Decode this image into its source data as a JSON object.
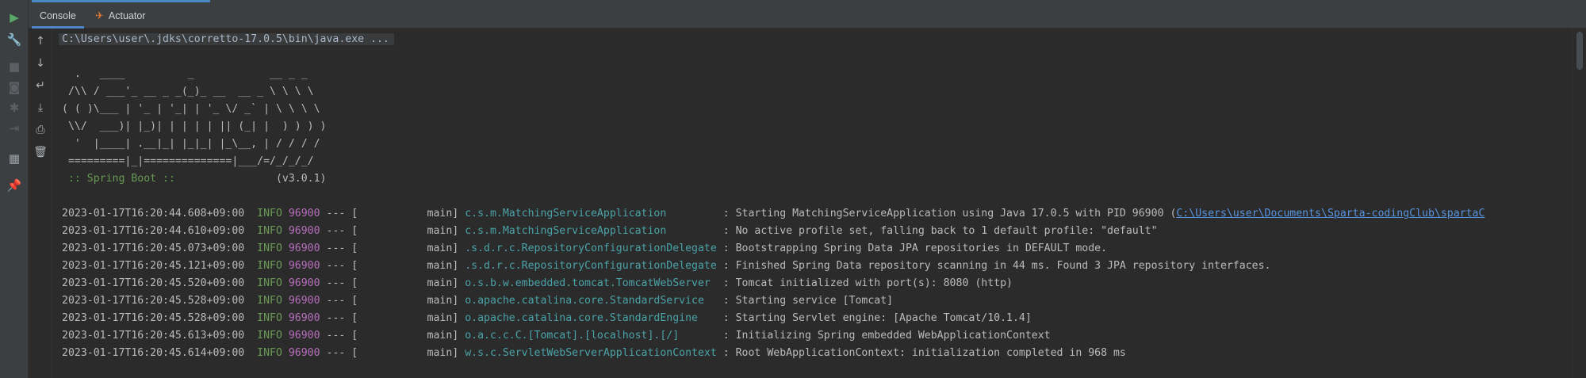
{
  "tabs": [
    {
      "label": "Console",
      "icon": "",
      "active": true
    },
    {
      "label": "Actuator",
      "icon": "actuator-icon",
      "active": false
    }
  ],
  "left_toolbar": [
    "run-icon",
    "wrench-icon",
    "stop-icon",
    "camera-icon",
    "debug-icon",
    "exit-icon",
    "layout-icon",
    "pin-icon"
  ],
  "console_toolbar": [
    "up-arrow-icon",
    "down-arrow-icon",
    "soft-wrap-icon",
    "scroll-to-end-icon",
    "print-icon",
    "trash-icon"
  ],
  "command": "C:\\Users\\user\\.jdks\\corretto-17.0.5\\bin\\java.exe ...",
  "banner": [
    "  .   ____          _            __ _ _",
    " /\\\\ / ___'_ __ _ _(_)_ __  __ _ \\ \\ \\ \\",
    "( ( )\\___ | '_ | '_| | '_ \\/ _` | \\ \\ \\ \\",
    " \\\\/  ___)| |_)| | | | | || (_| |  ) ) ) )",
    "  '  |____| .__|_| |_|_| |_\\__, | / / / /",
    " =========|_|==============|___/=/_/_/_/"
  ],
  "spring_label": " :: Spring Boot :: ",
  "spring_version": "               (v3.0.1)",
  "logs": [
    {
      "ts": "2023-01-17T16:20:44.608+09:00",
      "level": "INFO",
      "pid": "96900",
      "thread": "           main]",
      "logger": "c.s.m.MatchingServiceApplication        ",
      "msg": " : Starting MatchingServiceApplication using Java 17.0.5 with PID 96900 (",
      "link": "C:\\Users\\user\\Documents\\Sparta-codingClub\\spartaC"
    },
    {
      "ts": "2023-01-17T16:20:44.610+09:00",
      "level": "INFO",
      "pid": "96900",
      "thread": "           main]",
      "logger": "c.s.m.MatchingServiceApplication        ",
      "msg": " : No active profile set, falling back to 1 default profile: \"default\"",
      "link": ""
    },
    {
      "ts": "2023-01-17T16:20:45.073+09:00",
      "level": "INFO",
      "pid": "96900",
      "thread": "           main]",
      "logger": ".s.d.r.c.RepositoryConfigurationDelegate",
      "msg": " : Bootstrapping Spring Data JPA repositories in DEFAULT mode.",
      "link": ""
    },
    {
      "ts": "2023-01-17T16:20:45.121+09:00",
      "level": "INFO",
      "pid": "96900",
      "thread": "           main]",
      "logger": ".s.d.r.c.RepositoryConfigurationDelegate",
      "msg": " : Finished Spring Data repository scanning in 44 ms. Found 3 JPA repository interfaces.",
      "link": ""
    },
    {
      "ts": "2023-01-17T16:20:45.520+09:00",
      "level": "INFO",
      "pid": "96900",
      "thread": "           main]",
      "logger": "o.s.b.w.embedded.tomcat.TomcatWebServer ",
      "msg": " : Tomcat initialized with port(s): 8080 (http)",
      "link": ""
    },
    {
      "ts": "2023-01-17T16:20:45.528+09:00",
      "level": "INFO",
      "pid": "96900",
      "thread": "           main]",
      "logger": "o.apache.catalina.core.StandardService  ",
      "msg": " : Starting service [Tomcat]",
      "link": ""
    },
    {
      "ts": "2023-01-17T16:20:45.528+09:00",
      "level": "INFO",
      "pid": "96900",
      "thread": "           main]",
      "logger": "o.apache.catalina.core.StandardEngine   ",
      "msg": " : Starting Servlet engine: [Apache Tomcat/10.1.4]",
      "link": ""
    },
    {
      "ts": "2023-01-17T16:20:45.613+09:00",
      "level": "INFO",
      "pid": "96900",
      "thread": "           main]",
      "logger": "o.a.c.c.C.[Tomcat].[localhost].[/]      ",
      "msg": " : Initializing Spring embedded WebApplicationContext",
      "link": ""
    },
    {
      "ts": "2023-01-17T16:20:45.614+09:00",
      "level": "INFO",
      "pid": "96900",
      "thread": "           main]",
      "logger": "w.s.c.ServletWebServerApplicationContext",
      "msg": " : Root WebApplicationContext: initialization completed in 968 ms",
      "link": ""
    }
  ],
  "colors": {
    "background": "#2b2b2b",
    "info": "#6a9955",
    "pid": "#b86fbd",
    "logger": "#4aa3a8",
    "link": "#5894e0",
    "accent": "#4a88c7"
  }
}
